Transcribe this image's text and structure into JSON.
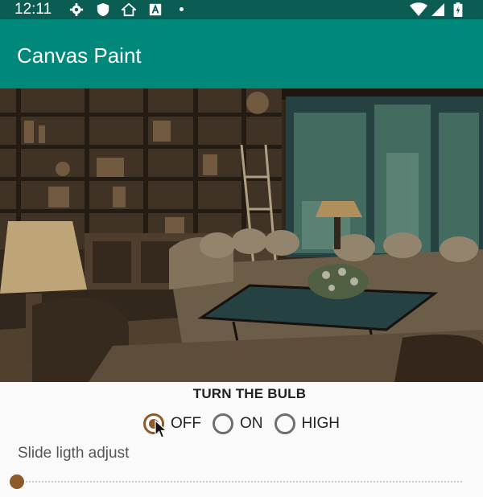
{
  "status_bar": {
    "time": "12:11",
    "icons": [
      "gear-icon",
      "shield-icon",
      "home-icon",
      "a-icon",
      "dot-icon",
      "wifi-icon",
      "signal-icon",
      "battery-icon"
    ]
  },
  "app_bar": {
    "title": "Canvas Paint"
  },
  "scene": {
    "description_icon": "living-room-image"
  },
  "bulb": {
    "heading": "TURN THE BULB",
    "options": [
      {
        "label": "OFF",
        "selected": true
      },
      {
        "label": "ON",
        "selected": false
      },
      {
        "label": "HIGH",
        "selected": false
      }
    ]
  },
  "slider": {
    "label": "Slide ligth adjust",
    "value": 0
  },
  "colors": {
    "status_bar": "#0b5c53",
    "app_bar": "#00897b",
    "accent": "#8d5a2b"
  }
}
